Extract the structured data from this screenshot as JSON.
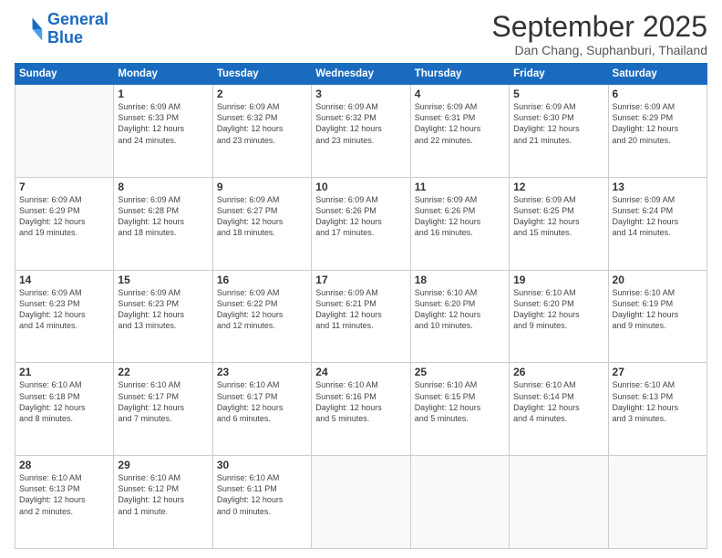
{
  "logo": {
    "line1": "General",
    "line2": "Blue"
  },
  "title": "September 2025",
  "subtitle": "Dan Chang, Suphanburi, Thailand",
  "weekdays": [
    "Sunday",
    "Monday",
    "Tuesday",
    "Wednesday",
    "Thursday",
    "Friday",
    "Saturday"
  ],
  "weeks": [
    [
      {
        "day": "",
        "info": ""
      },
      {
        "day": "1",
        "info": "Sunrise: 6:09 AM\nSunset: 6:33 PM\nDaylight: 12 hours\nand 24 minutes."
      },
      {
        "day": "2",
        "info": "Sunrise: 6:09 AM\nSunset: 6:32 PM\nDaylight: 12 hours\nand 23 minutes."
      },
      {
        "day": "3",
        "info": "Sunrise: 6:09 AM\nSunset: 6:32 PM\nDaylight: 12 hours\nand 23 minutes."
      },
      {
        "day": "4",
        "info": "Sunrise: 6:09 AM\nSunset: 6:31 PM\nDaylight: 12 hours\nand 22 minutes."
      },
      {
        "day": "5",
        "info": "Sunrise: 6:09 AM\nSunset: 6:30 PM\nDaylight: 12 hours\nand 21 minutes."
      },
      {
        "day": "6",
        "info": "Sunrise: 6:09 AM\nSunset: 6:29 PM\nDaylight: 12 hours\nand 20 minutes."
      }
    ],
    [
      {
        "day": "7",
        "info": "Sunrise: 6:09 AM\nSunset: 6:29 PM\nDaylight: 12 hours\nand 19 minutes."
      },
      {
        "day": "8",
        "info": "Sunrise: 6:09 AM\nSunset: 6:28 PM\nDaylight: 12 hours\nand 18 minutes."
      },
      {
        "day": "9",
        "info": "Sunrise: 6:09 AM\nSunset: 6:27 PM\nDaylight: 12 hours\nand 18 minutes."
      },
      {
        "day": "10",
        "info": "Sunrise: 6:09 AM\nSunset: 6:26 PM\nDaylight: 12 hours\nand 17 minutes."
      },
      {
        "day": "11",
        "info": "Sunrise: 6:09 AM\nSunset: 6:26 PM\nDaylight: 12 hours\nand 16 minutes."
      },
      {
        "day": "12",
        "info": "Sunrise: 6:09 AM\nSunset: 6:25 PM\nDaylight: 12 hours\nand 15 minutes."
      },
      {
        "day": "13",
        "info": "Sunrise: 6:09 AM\nSunset: 6:24 PM\nDaylight: 12 hours\nand 14 minutes."
      }
    ],
    [
      {
        "day": "14",
        "info": "Sunrise: 6:09 AM\nSunset: 6:23 PM\nDaylight: 12 hours\nand 14 minutes."
      },
      {
        "day": "15",
        "info": "Sunrise: 6:09 AM\nSunset: 6:23 PM\nDaylight: 12 hours\nand 13 minutes."
      },
      {
        "day": "16",
        "info": "Sunrise: 6:09 AM\nSunset: 6:22 PM\nDaylight: 12 hours\nand 12 minutes."
      },
      {
        "day": "17",
        "info": "Sunrise: 6:09 AM\nSunset: 6:21 PM\nDaylight: 12 hours\nand 11 minutes."
      },
      {
        "day": "18",
        "info": "Sunrise: 6:10 AM\nSunset: 6:20 PM\nDaylight: 12 hours\nand 10 minutes."
      },
      {
        "day": "19",
        "info": "Sunrise: 6:10 AM\nSunset: 6:20 PM\nDaylight: 12 hours\nand 9 minutes."
      },
      {
        "day": "20",
        "info": "Sunrise: 6:10 AM\nSunset: 6:19 PM\nDaylight: 12 hours\nand 9 minutes."
      }
    ],
    [
      {
        "day": "21",
        "info": "Sunrise: 6:10 AM\nSunset: 6:18 PM\nDaylight: 12 hours\nand 8 minutes."
      },
      {
        "day": "22",
        "info": "Sunrise: 6:10 AM\nSunset: 6:17 PM\nDaylight: 12 hours\nand 7 minutes."
      },
      {
        "day": "23",
        "info": "Sunrise: 6:10 AM\nSunset: 6:17 PM\nDaylight: 12 hours\nand 6 minutes."
      },
      {
        "day": "24",
        "info": "Sunrise: 6:10 AM\nSunset: 6:16 PM\nDaylight: 12 hours\nand 5 minutes."
      },
      {
        "day": "25",
        "info": "Sunrise: 6:10 AM\nSunset: 6:15 PM\nDaylight: 12 hours\nand 5 minutes."
      },
      {
        "day": "26",
        "info": "Sunrise: 6:10 AM\nSunset: 6:14 PM\nDaylight: 12 hours\nand 4 minutes."
      },
      {
        "day": "27",
        "info": "Sunrise: 6:10 AM\nSunset: 6:13 PM\nDaylight: 12 hours\nand 3 minutes."
      }
    ],
    [
      {
        "day": "28",
        "info": "Sunrise: 6:10 AM\nSunset: 6:13 PM\nDaylight: 12 hours\nand 2 minutes."
      },
      {
        "day": "29",
        "info": "Sunrise: 6:10 AM\nSunset: 6:12 PM\nDaylight: 12 hours\nand 1 minute."
      },
      {
        "day": "30",
        "info": "Sunrise: 6:10 AM\nSunset: 6:11 PM\nDaylight: 12 hours\nand 0 minutes."
      },
      {
        "day": "",
        "info": ""
      },
      {
        "day": "",
        "info": ""
      },
      {
        "day": "",
        "info": ""
      },
      {
        "day": "",
        "info": ""
      }
    ]
  ]
}
